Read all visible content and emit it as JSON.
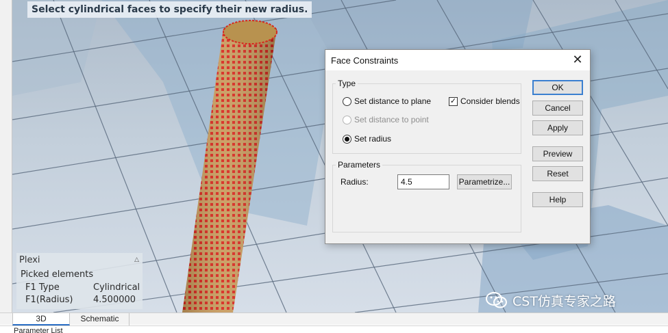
{
  "viewport": {
    "hint": "Select cylindrical faces to specify their new radius."
  },
  "info_panel": {
    "title": "Plexi",
    "subtitle": "Picked elements",
    "rows": [
      {
        "key": "F1 Type",
        "value": "Cylindrical"
      },
      {
        "key": "F1(Radius)",
        "value": "4.500000"
      }
    ],
    "collapse_icon": "chevron-up-icon"
  },
  "dialog": {
    "title": "Face Constraints",
    "close_icon": "close-icon",
    "type_group": {
      "legend": "Type",
      "options": [
        {
          "label": "Set distance to plane",
          "selected": false,
          "enabled": true
        },
        {
          "label": "Set distance to point",
          "selected": false,
          "enabled": false
        },
        {
          "label": "Set radius",
          "selected": true,
          "enabled": true
        }
      ],
      "consider_blends": {
        "label": "Consider blends",
        "checked": true
      }
    },
    "parameters_group": {
      "legend": "Parameters",
      "radius_label": "Radius:",
      "radius_value": "4.5",
      "parametrize_label": "Parametrize..."
    },
    "buttons": {
      "ok": "OK",
      "cancel": "Cancel",
      "apply": "Apply",
      "preview": "Preview",
      "reset": "Reset",
      "help": "Help"
    }
  },
  "tabs": [
    {
      "label": "3D",
      "active": true
    },
    {
      "label": "Schematic",
      "active": false
    }
  ],
  "bottom_panel": {
    "label": "Parameter List"
  },
  "watermark": {
    "text": "CST仿真专家之路",
    "icon": "wechat-icon"
  },
  "colors": {
    "accent": "#3a7fd0",
    "cylinder_fill": "#c8a064",
    "cylinder_dots": "#d42a1e"
  }
}
